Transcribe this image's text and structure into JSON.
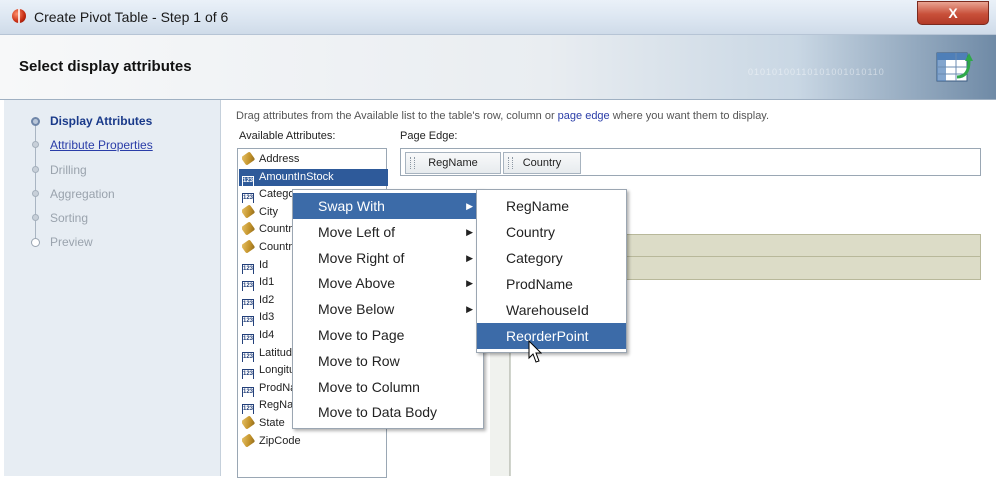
{
  "window": {
    "title": "Create Pivot Table - Step 1 of 6",
    "close_label": "X"
  },
  "header": {
    "page_title": "Select display attributes",
    "watermark": "01010100110101001010110"
  },
  "steps": [
    {
      "label": "Display Attributes",
      "state": "active"
    },
    {
      "label": "Attribute Properties",
      "state": "link"
    },
    {
      "label": "Drilling",
      "state": "disabled"
    },
    {
      "label": "Aggregation",
      "state": "disabled"
    },
    {
      "label": "Sorting",
      "state": "disabled"
    },
    {
      "label": "Preview",
      "state": "disabled"
    }
  ],
  "instructions": {
    "before": "Drag attributes from the Available list to the table's row, column or ",
    "link": "page edge",
    "after": " where you want them to display."
  },
  "available": {
    "label": "Available Attributes:",
    "items": [
      {
        "label": "Address",
        "icon": "string-icon"
      },
      {
        "label": "AmountInStock",
        "icon": "number-icon",
        "selected": true
      },
      {
        "label": "Category",
        "icon": "number-icon"
      },
      {
        "label": "City",
        "icon": "string-icon"
      },
      {
        "label": "Country",
        "icon": "string-icon"
      },
      {
        "label": "Country",
        "icon": "string-icon"
      },
      {
        "label": "Id",
        "icon": "number-icon"
      },
      {
        "label": "Id1",
        "icon": "number-icon"
      },
      {
        "label": "Id2",
        "icon": "number-icon"
      },
      {
        "label": "Id3",
        "icon": "number-icon"
      },
      {
        "label": "Id4",
        "icon": "number-icon"
      },
      {
        "label": "Latitude",
        "icon": "number-icon"
      },
      {
        "label": "Longitude",
        "icon": "number-icon"
      },
      {
        "label": "ProdName",
        "icon": "number-icon"
      },
      {
        "label": "RegName",
        "icon": "number-icon"
      },
      {
        "label": "State",
        "icon": "string-icon"
      },
      {
        "label": "ZipCode",
        "icon": "string-icon"
      }
    ]
  },
  "page_edge": {
    "label": "Page Edge:",
    "chips": [
      "RegName",
      "Country"
    ]
  },
  "context_menu": [
    {
      "label": "Swap With",
      "submenu": true,
      "highlighted": true
    },
    {
      "label": "Move Left of",
      "submenu": true
    },
    {
      "label": "Move Right of",
      "submenu": true
    },
    {
      "label": "Move Above",
      "submenu": true
    },
    {
      "label": "Move Below",
      "submenu": true
    },
    {
      "label": "Move to Page"
    },
    {
      "label": "Move to Row"
    },
    {
      "label": "Move to Column"
    },
    {
      "label": "Move to Data Body"
    }
  ],
  "submenu": [
    {
      "label": "RegName"
    },
    {
      "label": "Country"
    },
    {
      "label": "Category"
    },
    {
      "label": "ProdName"
    },
    {
      "label": "WarehouseId"
    },
    {
      "label": "ReorderPoint",
      "highlighted": true
    }
  ],
  "icons": {
    "submenu_arrow": "▶"
  },
  "colors": {
    "selection": "#3c6ba8",
    "link": "#2a3da8",
    "list_selection": "#2e5a9a"
  }
}
